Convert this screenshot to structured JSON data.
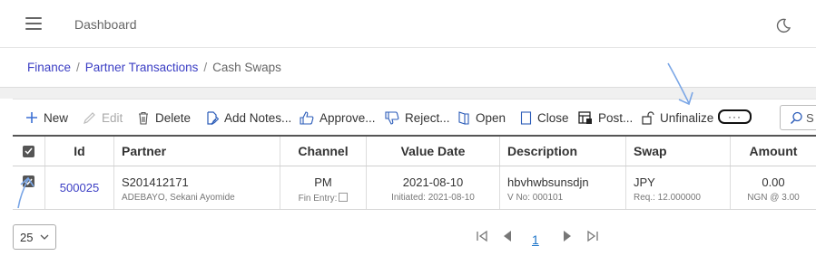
{
  "topbar": {
    "title": "Dashboard"
  },
  "breadcrumb": {
    "items": [
      "Finance",
      "Partner Transactions",
      "Cash Swaps"
    ],
    "separator": "/"
  },
  "toolbar": {
    "new": "New",
    "edit": "Edit",
    "delete": "Delete",
    "add_notes": "Add Notes...",
    "approve": "Approve...",
    "reject": "Reject...",
    "open": "Open",
    "close": "Close",
    "post": "Post...",
    "unfinalize": "Unfinalize",
    "more": "···",
    "search_text": "S"
  },
  "table": {
    "columns": [
      "Id",
      "Partner",
      "Channel",
      "Value Date",
      "Description",
      "Swap",
      "Amount"
    ],
    "rows": [
      {
        "checked": true,
        "id": "500025",
        "partner": "S201412171",
        "partner_sub": "ADEBAYO, Sekani Ayomide",
        "channel": "PM",
        "channel_sub": "Fin Entry:",
        "value_date": "2021-08-10",
        "value_date_sub": "Initiated: 2021-08-10",
        "description": "hbvhwbsunsdjn",
        "description_sub": "V No: 000101",
        "swap": "JPY",
        "swap_sub": "Req.: 12.000000",
        "amount": "0.00",
        "amount_sub": "NGN @ 3.00"
      }
    ]
  },
  "pager": {
    "page_size": "25",
    "current_page": "1"
  },
  "colors": {
    "link": "#3b3ec4",
    "page_link": "#1a73c8",
    "annotation": "#7aa6e6"
  }
}
